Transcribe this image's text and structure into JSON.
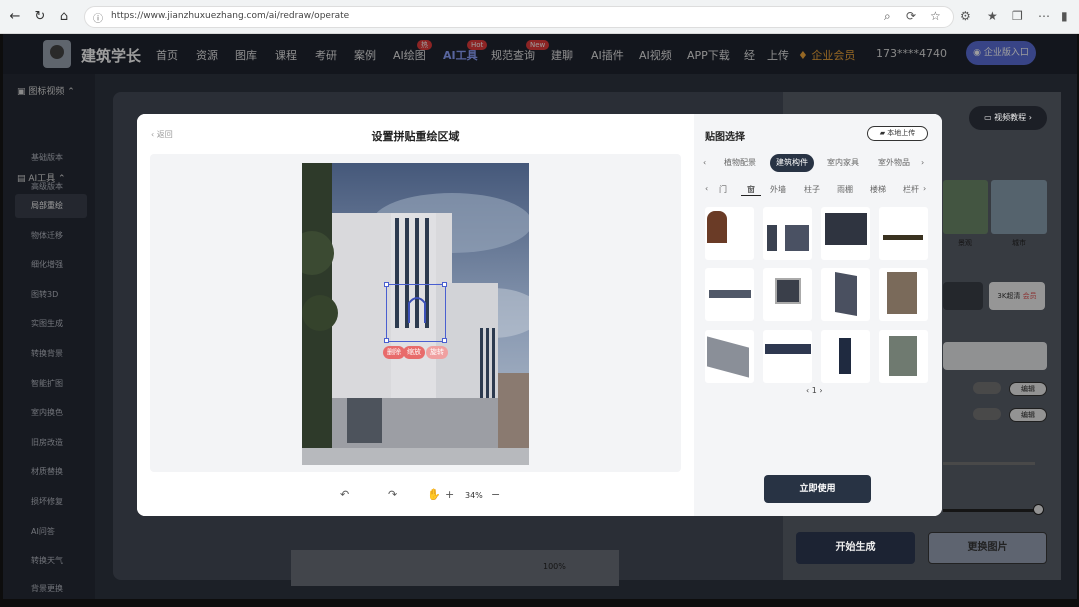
{
  "browser": {
    "url": "https://www.jianzhuxuezhang.com/ai/redraw/operate"
  },
  "app": {
    "brand": "建筑学长",
    "nav": [
      "首页",
      "资源",
      "图库",
      "课程",
      "考研",
      "案例",
      "AI绘图",
      "AI工具",
      "规范查询",
      "建聊",
      "AI插件",
      "AI视频",
      "APP下载",
      "经",
      "上传"
    ],
    "nav_badges": {
      "AI绘图": "热",
      "AI工具": "Hot",
      "规范查询": "New"
    },
    "vip_label": "企业会员",
    "phone": "173****4740",
    "enterprise_btn": "企业版入口",
    "colors": {
      "accent": "#283344",
      "selection": "#4a5fd0",
      "badge": "#e23a3a",
      "vip": "#f0a63a"
    }
  },
  "sidebar": {
    "groups": [
      {
        "label": "图标视频",
        "items": [
          "基础版本",
          "高级版本"
        ]
      },
      {
        "label": "AI工具",
        "items": [
          "局部重绘",
          "物体迁移",
          "细化增强",
          "图转3D",
          "实图生成",
          "转换背景",
          "智能扩图",
          "室内换色",
          "旧房改造",
          "材质替换",
          "损坏修复",
          "AI问答",
          "转换天气",
          "背景更换"
        ]
      }
    ],
    "active": "局部重绘"
  },
  "modal": {
    "back": "返回",
    "title": "设置拼贴重绘区域",
    "selection_chips": [
      "删除",
      "缩放",
      "旋转"
    ],
    "zoom": "34%",
    "right": {
      "title": "贴图选择",
      "upload": "本地上传",
      "categories": [
        "植物配景",
        "建筑构件",
        "室内家具",
        "室外物品"
      ],
      "active_category": "建筑构件",
      "subcategories": [
        "门",
        "窗",
        "外墙",
        "柱子",
        "雨棚",
        "楼梯",
        "栏杆"
      ],
      "active_sub": "窗",
      "page": "1",
      "use_button": "立即使用"
    }
  },
  "background": {
    "tutorial_btn": "视频教程",
    "gen_btn": "开始生成",
    "change_btn": "更换图片",
    "side_labels": [
      "景观",
      "城市"
    ],
    "opt_labels": [
      "3K超清",
      "会员"
    ],
    "edit_labels": [
      "编辑",
      "编辑"
    ],
    "bottom_zoom": "100%"
  }
}
